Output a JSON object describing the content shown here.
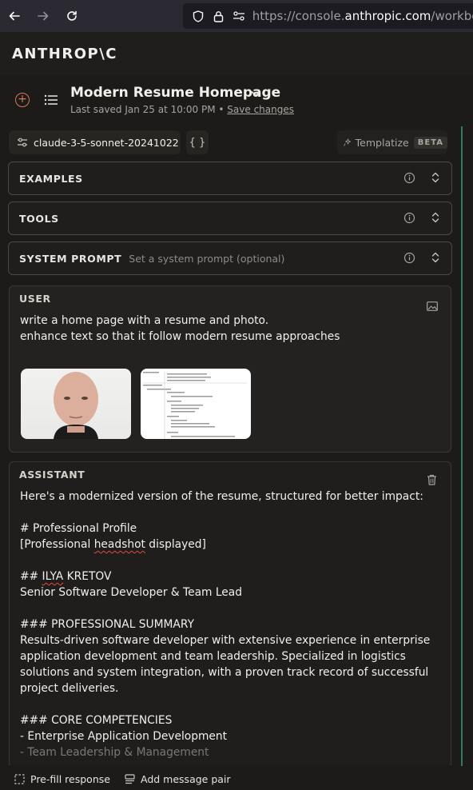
{
  "browser": {
    "url_prefix": "https://console.",
    "url_host": "anthropic.com",
    "url_path": "/workben"
  },
  "header": {
    "logo": "ANTHROP\\C"
  },
  "prompt": {
    "title": "Modern Resume Homepage",
    "saved_text": "Last saved Jan 25 at 10:00 PM • ",
    "save_changes": "Save changes"
  },
  "toolbar": {
    "model": "claude-3-5-sonnet-20241022",
    "braces": "{ }",
    "templatize": "Templatize",
    "beta": "BETA"
  },
  "sections": {
    "examples": "EXAMPLES",
    "tools": "TOOLS",
    "system_prompt": "SYSTEM PROMPT",
    "system_placeholder": "Set a system prompt (optional)"
  },
  "user": {
    "label": "USER",
    "line1": "write a home page with a resume and photo.",
    "line2": "enhance text so that it follow modern resume approaches"
  },
  "assistant": {
    "label": "ASSISTANT",
    "lines": {
      "l0": "Here's a modernized version of the resume, structured for better impact:",
      "l2": "# Professional Profile",
      "l3a": "[Professional ",
      "l3b": "headshot",
      "l3c": " displayed]",
      "l5a": "## ",
      "l5b": "ILYA",
      "l5c": " KRETOV",
      "l6": "Senior Software Developer & Team Lead",
      "l8": "### PROFESSIONAL SUMMARY",
      "l9": "Results-driven software developer with extensive experience in enterprise",
      "l10": "application development and team leadership. Specialized in logistics",
      "l11": "solutions and system integration, with a proven track record of successful",
      "l12": "project deliveries.",
      "l14": "### CORE COMPETENCIES",
      "l15": "- Enterprise Application Development",
      "l16": "- Team Leadership & Management"
    }
  },
  "footer": {
    "prefill": "Pre-fill response",
    "add_pair": "Add message pair"
  }
}
